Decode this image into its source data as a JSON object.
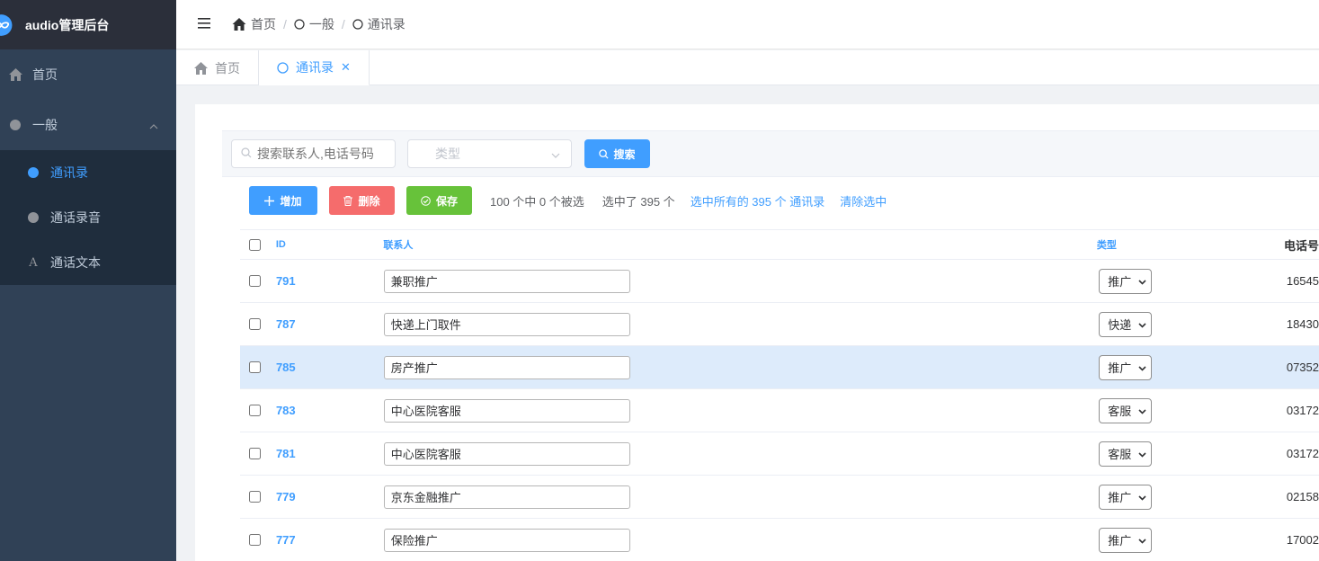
{
  "app": {
    "title": "audio管理后台"
  },
  "sidebar": {
    "items": [
      {
        "label": "首页"
      },
      {
        "label": "一般"
      }
    ],
    "subitems": [
      {
        "label": "通讯录"
      },
      {
        "label": "通话录音"
      },
      {
        "label": "通话文本"
      }
    ]
  },
  "breadcrumb": [
    "首页",
    "一般",
    "通讯录"
  ],
  "tabs": [
    {
      "label": "首页"
    },
    {
      "label": "通讯录"
    }
  ],
  "filter": {
    "search_placeholder": "搜索联系人,电话号码",
    "type_placeholder": "类型",
    "search_button": "搜索"
  },
  "toolbar": {
    "add": "增加",
    "delete": "删除",
    "save": "保存",
    "selection_info": "100 个中 0 个被选",
    "selected_count": "选中了 395 个",
    "select_all": "选中所有的 395 个 通讯录",
    "clear": "清除选中"
  },
  "table": {
    "headers": {
      "id": "ID",
      "name": "联系人",
      "type": "类型",
      "phone": "电话号"
    },
    "rows": [
      {
        "id": "791",
        "name": "兼职推广",
        "type": "推广",
        "phone": "16545"
      },
      {
        "id": "787",
        "name": "快递上门取件",
        "type": "快递",
        "phone": "18430"
      },
      {
        "id": "785",
        "name": "房产推广",
        "type": "推广",
        "phone": "07352"
      },
      {
        "id": "783",
        "name": "中心医院客服",
        "type": "客服",
        "phone": "03172"
      },
      {
        "id": "781",
        "name": "中心医院客服",
        "type": "客服",
        "phone": "03172"
      },
      {
        "id": "779",
        "name": "京东金融推广",
        "type": "推广",
        "phone": "02158"
      },
      {
        "id": "777",
        "name": "保险推广",
        "type": "推广",
        "phone": "17002"
      }
    ]
  },
  "colors": {
    "primary": "#409eff",
    "danger": "#f56c6c",
    "success": "#67c23a",
    "sidebar": "#304156",
    "row_highlight": "#ddebfb"
  }
}
